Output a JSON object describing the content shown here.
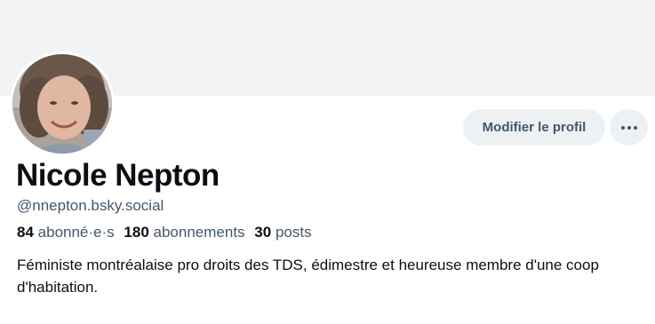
{
  "profile": {
    "display_name": "Nicole Nepton",
    "handle": "@nnepton.bsky.social",
    "bio": "Féministe montréalaise pro droits des TDS, édimestre et heureuse membre d'une coop d'habitation."
  },
  "stats": {
    "followers_count": "84",
    "followers_label": "abonné·e·s",
    "following_count": "180",
    "following_label": "abonnements",
    "posts_count": "30",
    "posts_label": "posts"
  },
  "actions": {
    "edit_profile_label": "Modifier le profil",
    "more_icon": "ellipsis-icon"
  },
  "colors": {
    "banner": "#f1f3f5",
    "button_bg": "#eef1f4",
    "muted_text": "#42576c",
    "primary_text": "#0b0f14"
  }
}
